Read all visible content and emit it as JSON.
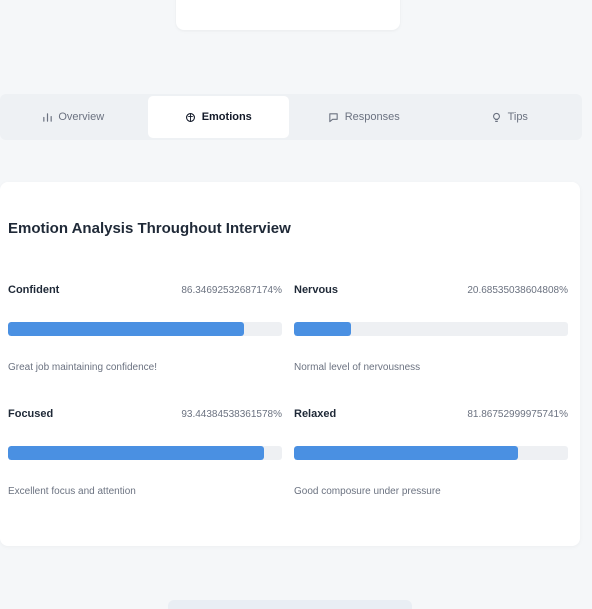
{
  "tabs": [
    {
      "label": "Overview",
      "icon": "bar-chart-icon",
      "active": false
    },
    {
      "label": "Emotions",
      "icon": "brain-icon",
      "active": true
    },
    {
      "label": "Responses",
      "icon": "message-square-icon",
      "active": false
    },
    {
      "label": "Tips",
      "icon": "lightbulb-icon",
      "active": false
    }
  ],
  "analysis": {
    "title": "Emotion Analysis Throughout Interview",
    "emotions": [
      {
        "name": "Confident",
        "value": "86.34692532687174%",
        "level": 0.863,
        "note": "Great job maintaining confidence!"
      },
      {
        "name": "Nervous",
        "value": "20.68535038604808%",
        "level": 0.207,
        "note": "Normal level of nervousness"
      },
      {
        "name": "Focused",
        "value": "93.44384538361578%",
        "level": 0.934,
        "note": "Excellent focus and attention"
      },
      {
        "name": "Relaxed",
        "value": "81.86752999975741%",
        "level": 0.819,
        "note": "Good composure under pressure"
      }
    ]
  },
  "colors": {
    "accent": "#4a90e2",
    "track": "#eef0f3",
    "background": "#f5f7f9"
  }
}
